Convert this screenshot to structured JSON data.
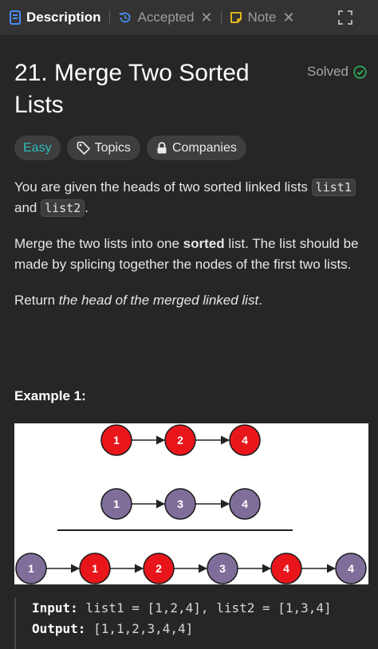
{
  "tabs": [
    {
      "label": "Description",
      "icon": "description-icon",
      "active": true
    },
    {
      "label": "Accepted",
      "icon": "history-icon",
      "closable": true
    },
    {
      "label": "Note",
      "icon": "note-icon",
      "closable": true
    }
  ],
  "colors": {
    "background": "#262626",
    "tabbar": "#333333",
    "easy": "#2cbbba",
    "solved_check": "#2db55d",
    "node_red": "#e8161b",
    "node_purple": "#7f6e9a",
    "description_icon": "#4b8ef5",
    "history_icon": "#4b8ef5",
    "note_icon": "#f5c518"
  },
  "problem": {
    "title": "21. Merge Two Sorted Lists",
    "status": "Solved",
    "difficulty": "Easy",
    "topics_label": "Topics",
    "companies_label": "Companies"
  },
  "description": {
    "p1": {
      "before": "You are given the heads of two sorted linked lists ",
      "code1": "list1",
      "middle": " and ",
      "code2": "list2",
      "after": "."
    },
    "p2": {
      "before": "Merge the two lists into one ",
      "bold": "sorted",
      "after": " list. The list should be made by splicing together the nodes of the first two lists."
    },
    "p3": {
      "before": "Return ",
      "italic": "the head of the merged linked list",
      "after": "."
    }
  },
  "example": {
    "title": "Example 1:",
    "diagram": {
      "list1": [
        "1",
        "2",
        "4"
      ],
      "list2": [
        "1",
        "3",
        "4"
      ],
      "merged": [
        {
          "value": "1",
          "color": "purple"
        },
        {
          "value": "1",
          "color": "red"
        },
        {
          "value": "2",
          "color": "red"
        },
        {
          "value": "3",
          "color": "purple"
        },
        {
          "value": "4",
          "color": "red"
        },
        {
          "value": "4",
          "color": "purple"
        }
      ]
    },
    "input_label": "Input:",
    "input_value": "list1 = [1,2,4], list2 = [1,3,4]",
    "output_label": "Output:",
    "output_value": "[1,1,2,3,4,4]"
  }
}
